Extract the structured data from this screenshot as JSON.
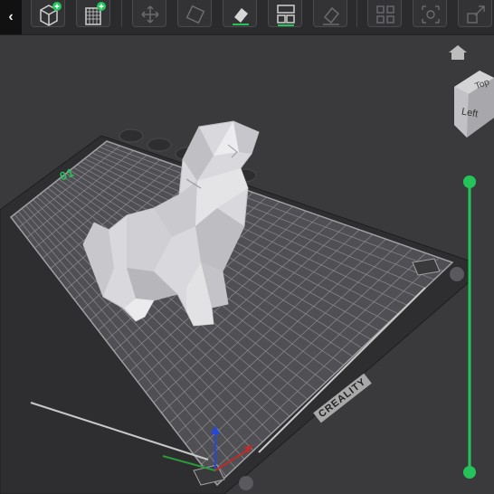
{
  "toolbar": {
    "collapse_glyph": "‹",
    "buttons": [
      {
        "name": "add-model-button",
        "icon": "cube-plus-icon"
      },
      {
        "name": "add-plate-button",
        "icon": "grid-plus-icon"
      },
      {
        "name": "move-button",
        "icon": "move-arrows-icon"
      },
      {
        "name": "rotate-button",
        "icon": "rotate-icon"
      },
      {
        "name": "lay-on-face-button",
        "icon": "eraser-icon"
      },
      {
        "name": "arrange-button",
        "icon": "layout-icon"
      },
      {
        "name": "support-button",
        "icon": "paint-icon"
      },
      {
        "name": "split-button",
        "icon": "split-icon"
      },
      {
        "name": "orient-button",
        "icon": "gear-grid-icon"
      },
      {
        "name": "scale-button",
        "icon": "scale-icon"
      }
    ]
  },
  "plate": {
    "number": "01",
    "brand": "CREALITY"
  },
  "view_cube": {
    "top_label": "Top",
    "left_label": "Left"
  },
  "colors": {
    "accent": "#25c45a",
    "background": "#3a3a3d",
    "toolbar": "#2b2b2d",
    "bed": "#505054",
    "model": "#d9d9dd"
  },
  "layer_slider": {
    "top_handle": "max-layer",
    "bottom_handle": "min-layer"
  }
}
